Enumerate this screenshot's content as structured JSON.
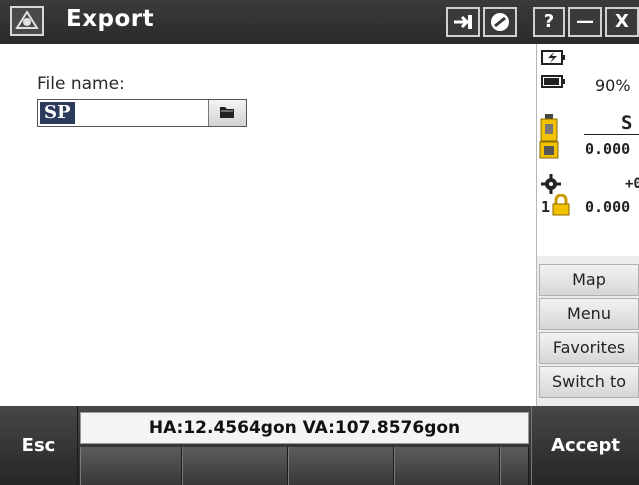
{
  "window": {
    "title": "Export"
  },
  "title_buttons": {
    "help": "?",
    "minimize": "—",
    "close": "X"
  },
  "form": {
    "file_name_label": "File name:",
    "file_name_value": "SP"
  },
  "status": {
    "battery_percent": "90%",
    "instrument_code": "S",
    "instrument_value": "0.000",
    "target_offset": "+0",
    "target_number": "1",
    "target_value": "0.000"
  },
  "side_menu": {
    "map": "Map",
    "menu": "Menu",
    "favorites": "Favorites",
    "switch_to": "Switch to"
  },
  "bottom_bar": {
    "esc": "Esc",
    "angles": "HA:12.4564gon  VA:107.8576gon",
    "accept": "Accept"
  },
  "colors": {
    "titlebar": "#2f2f2f",
    "selection": "#2c3a5c",
    "battery_indicator": "#f2c200"
  },
  "icons": [
    "trimble-app-icon",
    "pin-icon",
    "dial-icon",
    "charging-battery-icon",
    "battery-icon",
    "instrument-icon",
    "target-icon",
    "lock-icon",
    "folder-icon"
  ]
}
